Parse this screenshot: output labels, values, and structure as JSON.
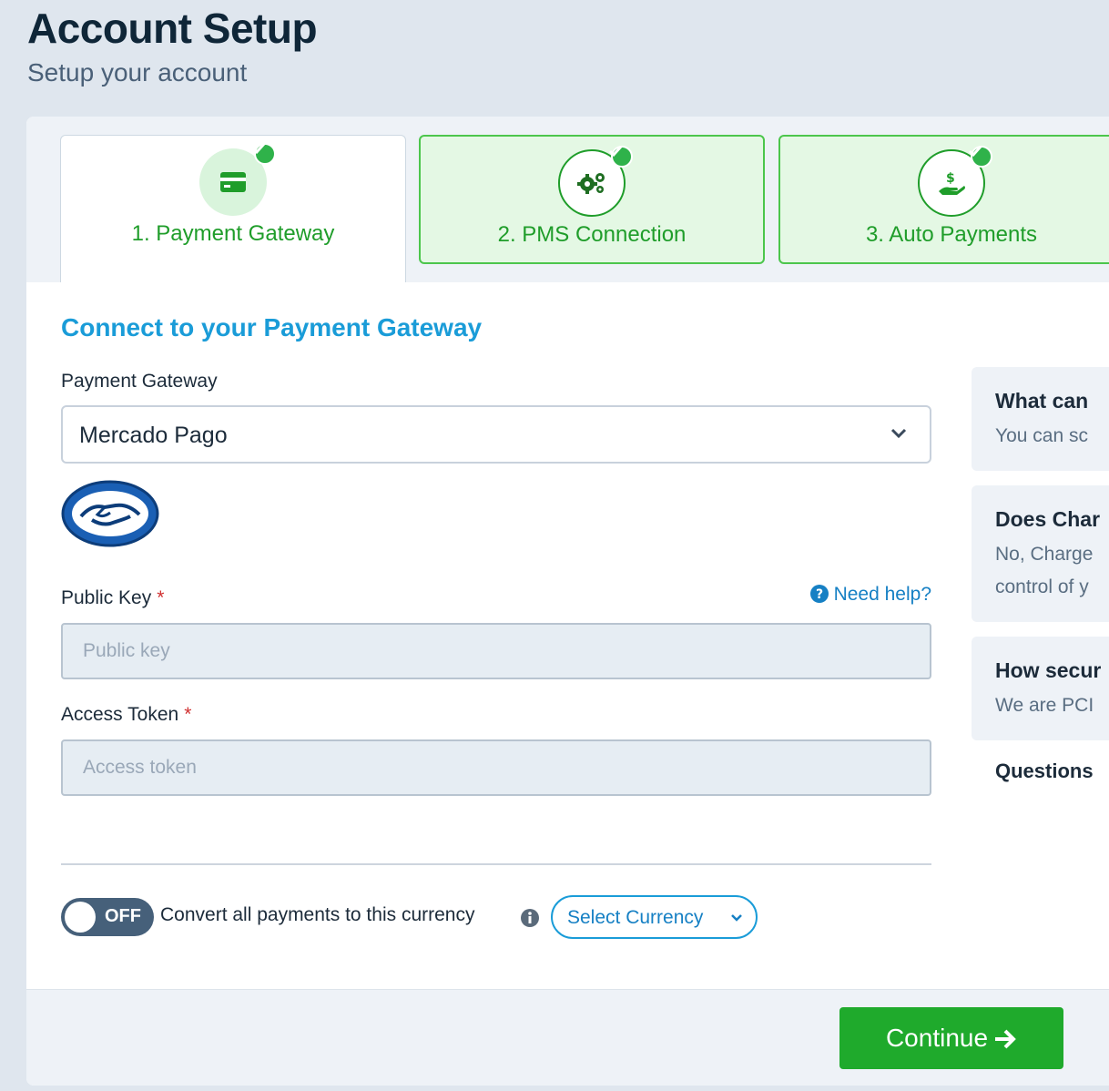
{
  "header": {
    "title": "Account Setup",
    "subtitle": "Setup your account"
  },
  "steps": [
    {
      "label": "1. Payment Gateway",
      "icon": "credit-card-icon",
      "state": "active"
    },
    {
      "label": "2. PMS Connection",
      "icon": "gears-icon",
      "state": "complete"
    },
    {
      "label": "3. Auto Payments",
      "icon": "hand-dollar-icon",
      "state": "complete"
    }
  ],
  "form": {
    "section_title": "Connect to your Payment Gateway",
    "gateway_label": "Payment Gateway",
    "gateway_value": "Mercado Pago",
    "public_key_label": "Public Key",
    "public_key_placeholder": "Public key",
    "public_key_value": "",
    "access_token_label": "Access Token",
    "access_token_placeholder": "Access token",
    "access_token_value": "",
    "required_marker": "*",
    "help_link": "Need help?",
    "toggle_state": "OFF",
    "convert_label": "Convert all payments to this currency",
    "currency_select": "Select Currency"
  },
  "faq": {
    "items": [
      {
        "question": "What can",
        "answer": [
          "You can sc"
        ]
      },
      {
        "question": "Does Char",
        "answer": [
          "No, Charge",
          "control of y"
        ]
      },
      {
        "question": "How secur",
        "answer": [
          "We are PCI"
        ]
      }
    ],
    "questions_label": "Questions"
  },
  "footer": {
    "continue_label": "Continue"
  },
  "colors": {
    "accent_green": "#1faa2c",
    "accent_blue": "#1a9cd8",
    "background": "#dfe6ee"
  }
}
